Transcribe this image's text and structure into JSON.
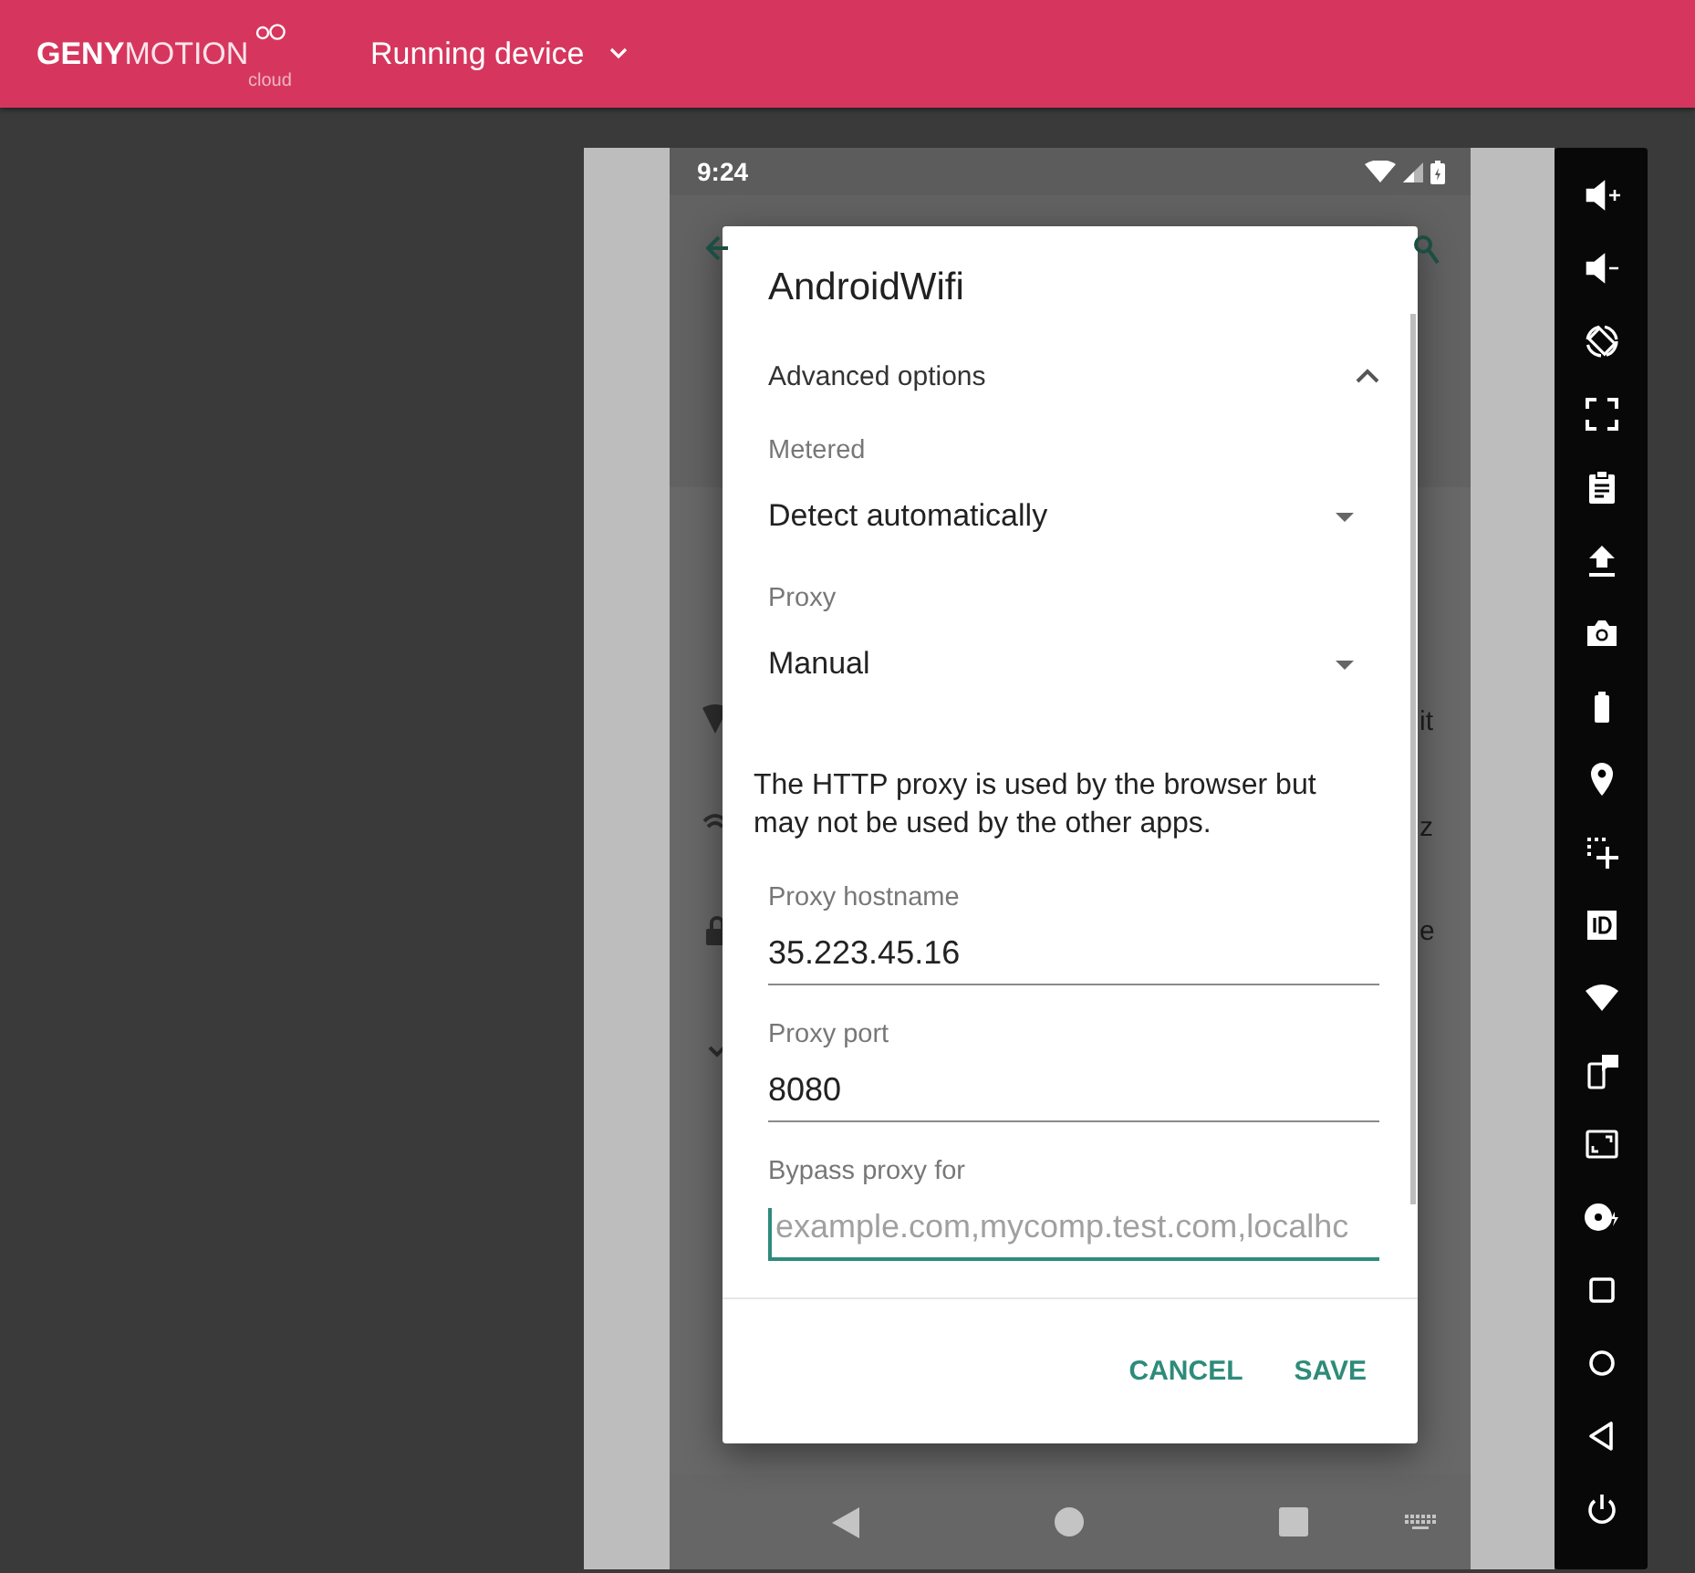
{
  "header": {
    "logo": {
      "bold": "GENY",
      "light": "MOTION",
      "sub": "cloud"
    },
    "device_menu": {
      "label": "Running device"
    }
  },
  "phone": {
    "status_bar": {
      "time": "9:24"
    },
    "background_fragments": [
      "it",
      "z",
      "e"
    ],
    "dialog": {
      "title": "AndroidWifi",
      "section": {
        "label": "Advanced options",
        "expanded": true
      },
      "fields": [
        {
          "kind": "dropdown",
          "label": "Metered",
          "value": "Detect automatically"
        },
        {
          "kind": "dropdown",
          "label": "Proxy",
          "value": "Manual"
        },
        {
          "kind": "note",
          "text": "The HTTP proxy is used by the browser but may not be used by the other apps."
        },
        {
          "kind": "text",
          "label": "Proxy hostname",
          "value": "35.223.45.16",
          "focused": false
        },
        {
          "kind": "text",
          "label": "Proxy port",
          "value": "8080",
          "focused": false
        },
        {
          "kind": "text",
          "label": "Bypass proxy for",
          "placeholder": "example.com,mycomp.test.com,localhc",
          "focused": true
        }
      ],
      "buttons": [
        "CANCEL",
        "SAVE"
      ]
    }
  }
}
